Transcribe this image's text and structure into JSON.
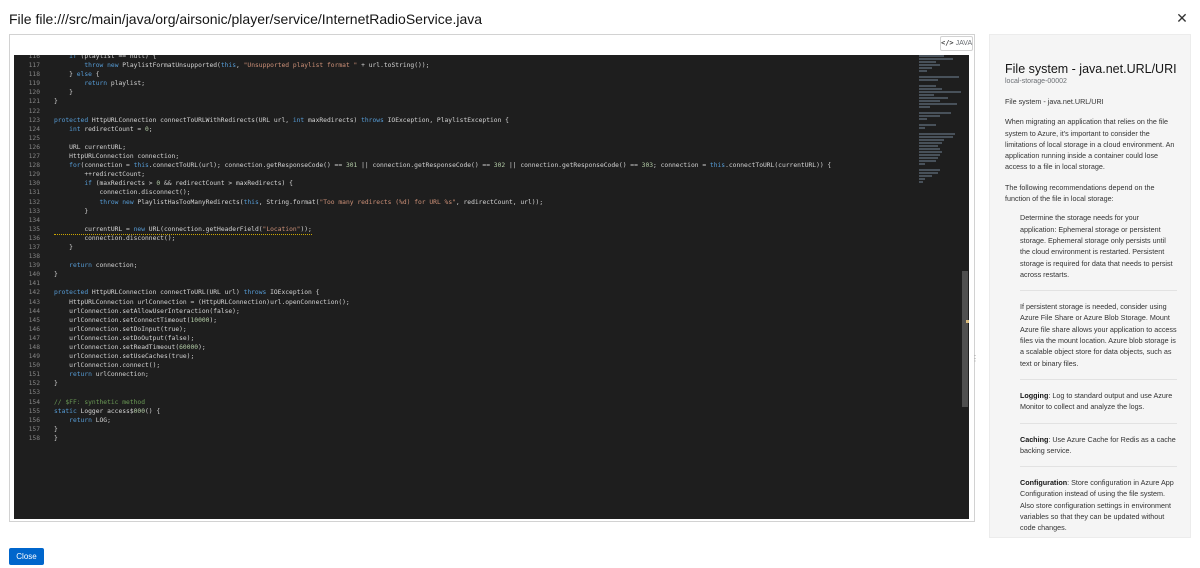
{
  "modal": {
    "title": "File file:///src/main/java/org/airsonic/player/service/InternetRadioService.java",
    "close_icon": "close-icon",
    "close_button_label": "Close"
  },
  "editor": {
    "language_tab": "JAVA",
    "lines": [
      {
        "n": "116",
        "t": "    if (playlist == null) {"
      },
      {
        "n": "117",
        "t": "        throw new PlaylistFormatUnsupported(this, \"Unsupported playlist format \" + url.toString());"
      },
      {
        "n": "118",
        "t": "    } else {"
      },
      {
        "n": "119",
        "t": "        return playlist;"
      },
      {
        "n": "120",
        "t": "    }"
      },
      {
        "n": "121",
        "t": "}"
      },
      {
        "n": "122",
        "t": ""
      },
      {
        "n": "123",
        "t": "protected HttpURLConnection connectToURLWithRedirects(URL url, int maxRedirects) throws IOException, PlaylistException {"
      },
      {
        "n": "124",
        "t": "    int redirectCount = 0;"
      },
      {
        "n": "125",
        "t": ""
      },
      {
        "n": "126",
        "t": "    URL currentURL;"
      },
      {
        "n": "127",
        "t": "    HttpURLConnection connection;"
      },
      {
        "n": "128",
        "t": "    for(connection = this.connectToURL(url); connection.getResponseCode() == 301 || connection.getResponseCode() == 302 || connection.getResponseCode() == 303; connection = this.connectToURL(currentURL)) {"
      },
      {
        "n": "129",
        "t": "        ++redirectCount;"
      },
      {
        "n": "130",
        "t": "        if (maxRedirects > 0 && redirectCount > maxRedirects) {"
      },
      {
        "n": "131",
        "t": "            connection.disconnect();"
      },
      {
        "n": "132",
        "t": "            throw new PlaylistHasTooManyRedirects(this, String.format(\"Too many redirects (%d) for URL %s\", redirectCount, url));"
      },
      {
        "n": "133",
        "t": "        }"
      },
      {
        "n": "134",
        "t": ""
      },
      {
        "n": "135",
        "t": "        currentURL = new URL(connection.getHeaderField(\"Location\"));"
      },
      {
        "n": "136",
        "t": "        connection.disconnect();"
      },
      {
        "n": "137",
        "t": "    }"
      },
      {
        "n": "138",
        "t": ""
      },
      {
        "n": "139",
        "t": "    return connection;"
      },
      {
        "n": "140",
        "t": "}"
      },
      {
        "n": "141",
        "t": ""
      },
      {
        "n": "142",
        "t": "protected HttpURLConnection connectToURL(URL url) throws IOException {"
      },
      {
        "n": "143",
        "t": "    HttpURLConnection urlConnection = (HttpURLConnection)url.openConnection();"
      },
      {
        "n": "144",
        "t": "    urlConnection.setAllowUserInteraction(false);"
      },
      {
        "n": "145",
        "t": "    urlConnection.setConnectTimeout(10000);"
      },
      {
        "n": "146",
        "t": "    urlConnection.setDoInput(true);"
      },
      {
        "n": "147",
        "t": "    urlConnection.setDoOutput(false);"
      },
      {
        "n": "148",
        "t": "    urlConnection.setReadTimeout(60000);"
      },
      {
        "n": "149",
        "t": "    urlConnection.setUseCaches(true);"
      },
      {
        "n": "150",
        "t": "    urlConnection.connect();"
      },
      {
        "n": "151",
        "t": "    return urlConnection;"
      },
      {
        "n": "152",
        "t": "}"
      },
      {
        "n": "153",
        "t": ""
      },
      {
        "n": "154",
        "t": "// $FF: synthetic method"
      },
      {
        "n": "155",
        "t": "static Logger access$000() {"
      },
      {
        "n": "156",
        "t": "    return LOG;"
      },
      {
        "n": "157",
        "t": "}"
      },
      {
        "n": "158",
        "t": "}"
      }
    ]
  },
  "sidebar": {
    "title": "File system - java.net.URL/URI",
    "rule_id": "local-storage-00002",
    "heading_line": "File system - java.net.URL/URI",
    "intro": "When migrating an application that relies on the file system to Azure, it's important to consider the limitations of local storage in a cloud environment. An application running inside a container could lose access to a file in local storage.",
    "recommend_intro": "The following recommendations depend on the function of the file in local storage:",
    "items": [
      {
        "label": "",
        "text": "Determine the storage needs for your application: Ephemeral storage or persistent storage. Ephemeral storage only persists until the cloud environment is restarted. Persistent storage is required for data that needs to persist across restarts."
      },
      {
        "label": "",
        "text": "If persistent storage is needed, consider using Azure File Share or Azure Blob Storage. Mount Azure file share allows your application to access files via the mount location. Azure blob storage is a scalable object store for data objects, such as text or binary files."
      },
      {
        "label": "Logging",
        "text": ": Log to standard output and use Azure Monitor to collect and analyze the logs."
      },
      {
        "label": "Caching",
        "text": ": Use Azure Cache for Redis as a cache backing service."
      },
      {
        "label": "Configuration",
        "text": ": Store configuration in Azure App Configuration instead of using the file system. Also store configuration settings in environment variables so that they can be updated without code changes."
      }
    ]
  }
}
